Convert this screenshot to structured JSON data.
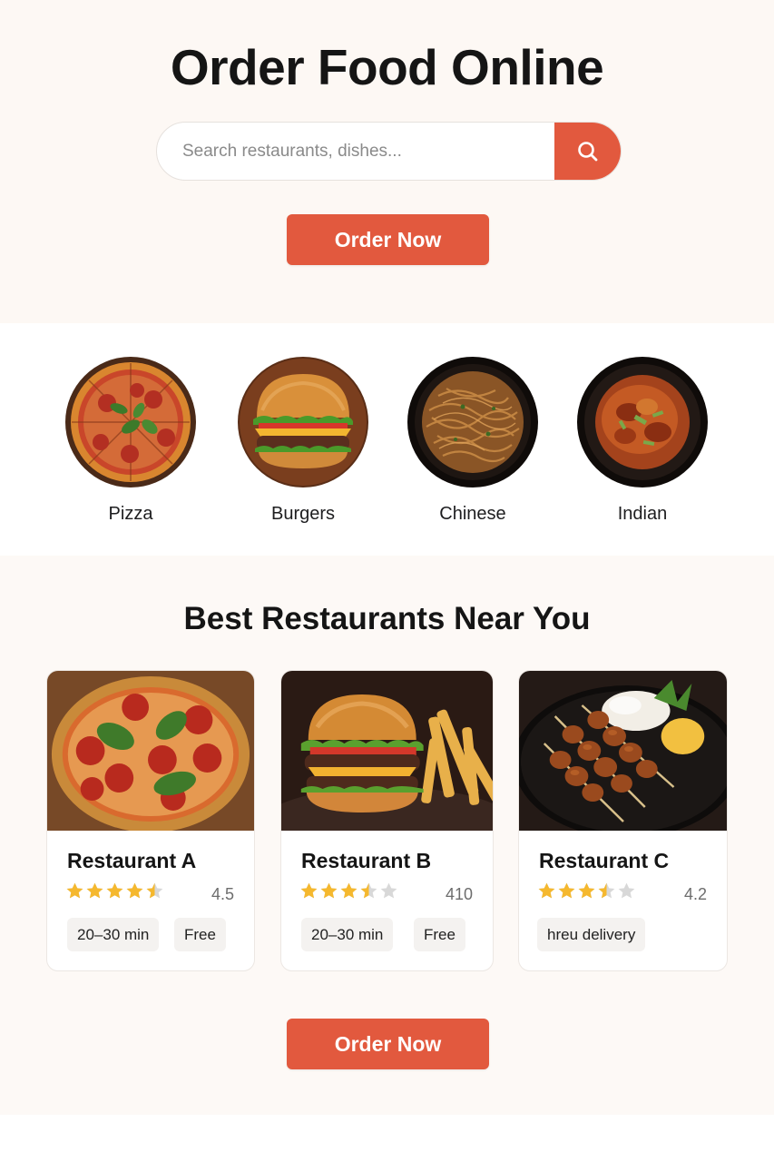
{
  "hero": {
    "title": "Order Food Online",
    "search_placeholder": "Search restaurants, dishes...",
    "search_icon": "search-icon",
    "order_button": "Order Now"
  },
  "categories": [
    {
      "label": "Pizza",
      "icon": "pizza-image"
    },
    {
      "label": "Burgers",
      "icon": "burger-image"
    },
    {
      "label": "Chinese",
      "icon": "noodles-image"
    },
    {
      "label": "Indian",
      "icon": "curry-image"
    }
  ],
  "restaurants": {
    "title": "Best Restaurants Near You",
    "cards": [
      {
        "name": "Restaurant A",
        "rating": "4.5",
        "stars": 4.5,
        "tags": [
          "20–30 min",
          "Free"
        ],
        "image": "pizza-photo"
      },
      {
        "name": "Restaurant B",
        "rating": "410",
        "stars": 3.5,
        "tags": [
          "20–30 min",
          "Free"
        ],
        "image": "burger-fries-photo"
      },
      {
        "name": "Restaurant C",
        "rating": "4.2",
        "stars": 3.5,
        "tags": [
          "hreu delivery"
        ],
        "image": "skewers-rice-photo"
      }
    ]
  },
  "footer": {
    "order_button": "Order Now"
  },
  "colors": {
    "accent": "#e2593e",
    "hero_bg": "#fdf8f4",
    "section_bg": "#fdf9f6",
    "star": "#f5b82e"
  }
}
